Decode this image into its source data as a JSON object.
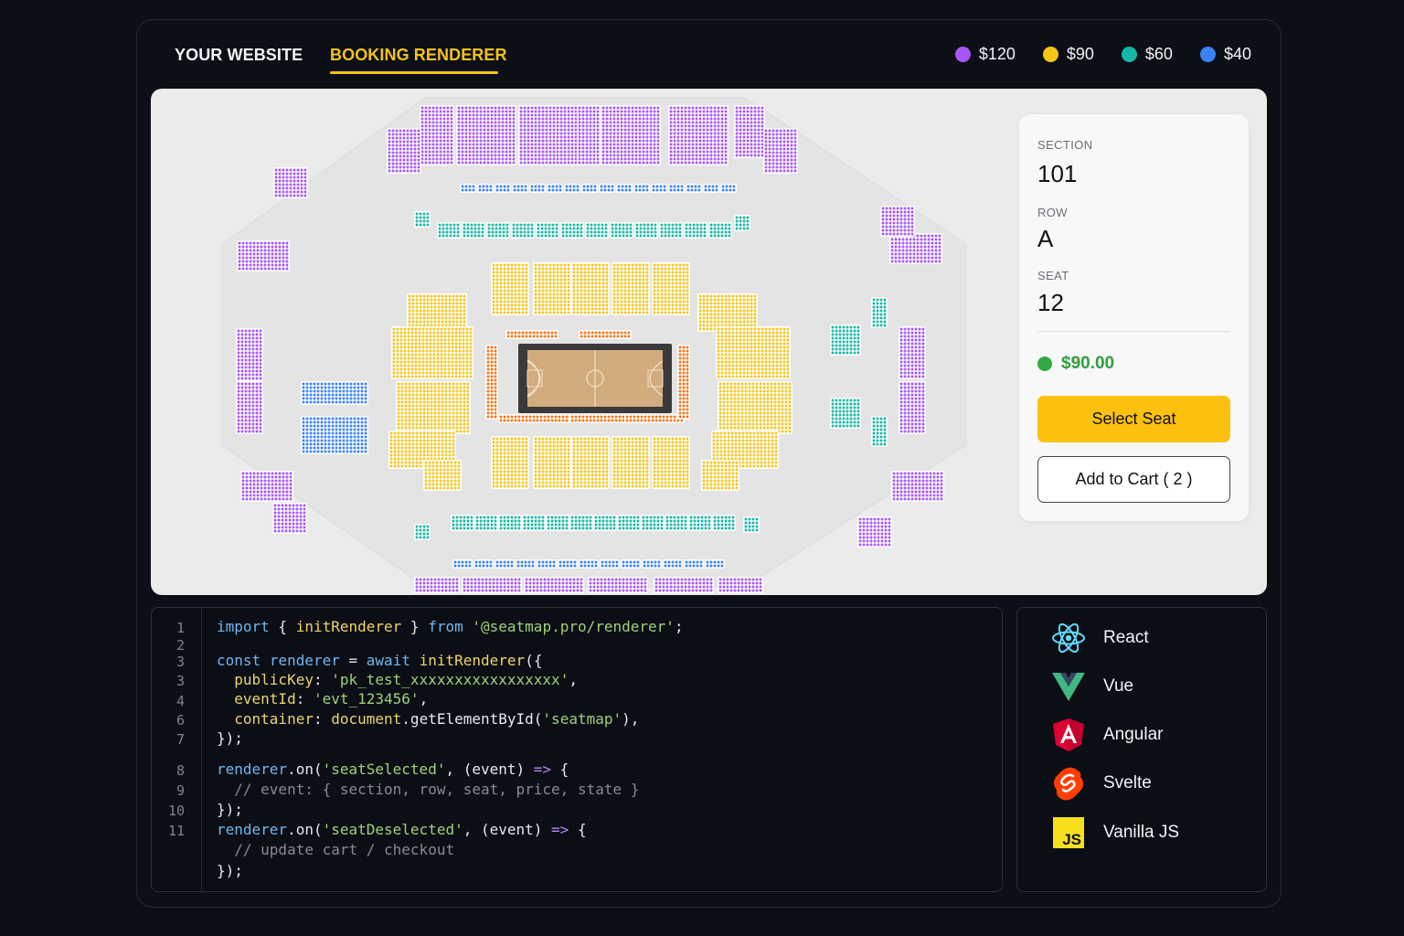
{
  "header": {
    "tabs": [
      {
        "label": "YOUR WEBSITE",
        "active": false
      },
      {
        "label": "BOOKING RENDERER",
        "active": true
      }
    ]
  },
  "legend": [
    {
      "label": "$120",
      "color": "#a855f7"
    },
    {
      "label": "$90",
      "color": "#f5c518"
    },
    {
      "label": "$60",
      "color": "#14b8a6"
    },
    {
      "label": "$40",
      "color": "#3b82f6"
    }
  ],
  "seat_map": {
    "venue": "basketball arena",
    "section_colors": {
      "upper": "#a855f7",
      "lower": "#f5c518",
      "club": "#14b8a6",
      "box": "#3b82f6",
      "courtside": "#f97316"
    }
  },
  "info_card": {
    "section_label": "SECTION",
    "section_value": "101",
    "row_label": "ROW",
    "row_value": "A",
    "seat_label": "SEAT",
    "seat_value": "12",
    "price": "$90.00",
    "price_color": "#33a843",
    "select_button": "Select Seat",
    "cart_button": "Add to Cart ( 2 )"
  },
  "code": {
    "line_numbers": [
      "1",
      "2",
      "3",
      "3",
      "4",
      "6",
      "7",
      "8",
      "9",
      "10",
      "11"
    ],
    "lines": [
      "import { initRenderer } from '@seatmap.pro/renderer';",
      "const renderer = await initRenderer({",
      "  publicKey: 'pk_test_xxxxxxxxxxxxxxxxx',",
      "  eventId: 'evt_123456',",
      "  container: document.getElementById('seatmap'),",
      "});",
      "renderer.on('seatSelected', (event) => {",
      "  // event: { section, row, seat, price, state }",
      "});",
      "renderer.on('seatDeselected', (event) => {",
      "  // update cart / checkout",
      "});"
    ]
  },
  "frameworks": [
    {
      "name": "React",
      "icon": "react-icon"
    },
    {
      "name": "Vue",
      "icon": "vue-icon"
    },
    {
      "name": "Angular",
      "icon": "angular-icon"
    },
    {
      "name": "Svelte",
      "icon": "svelte-icon"
    },
    {
      "name": "Vanilla JS",
      "icon": "javascript-icon",
      "icon_text": "JS"
    }
  ]
}
